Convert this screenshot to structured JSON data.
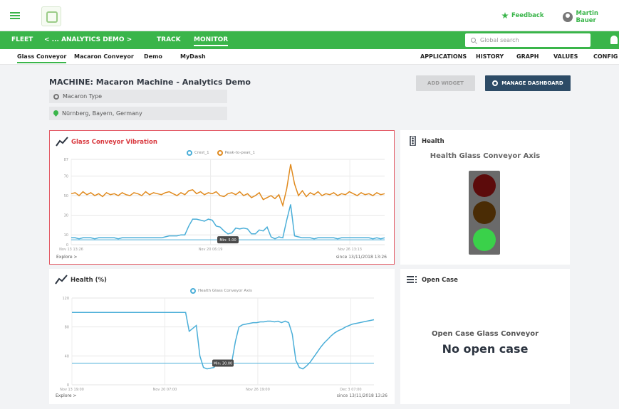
{
  "header": {
    "feedback": "Feedback",
    "user": "Martin Bauer"
  },
  "nav": {
    "fleet": "FLEET",
    "crumb": "< ... ANALYTICS DEMO >",
    "track": "TRACK",
    "monitor": "MONITOR",
    "search_placeholder": "Global search"
  },
  "subnav": {
    "left": [
      "Glass Conveyor",
      "Macaron Conveyor",
      "Demo",
      "MyDash"
    ],
    "right": [
      "APPLICATIONS",
      "HISTORY",
      "GRAPH",
      "VALUES",
      "CONFIG"
    ]
  },
  "page": {
    "title": "MACHINE: Macaron Machine - Analytics Demo",
    "type": "Macaron Type",
    "location": "Nürnberg, Bayern, Germany",
    "add_widget": "ADD WIDGET",
    "manage_dashboard": "MANAGE DASHBOARD"
  },
  "widgets": {
    "vibration": {
      "title": "Glass Conveyor Vibration",
      "explore": "Explore >",
      "since": "since 13/11/2018 13:26",
      "min_label": "Min: 5.00"
    },
    "health_light": {
      "title": "Health",
      "subtitle": "Health Glass Conveyor Axis",
      "colors": {
        "red": "#5c0b0b",
        "amber": "#4a2c05",
        "green": "#3ad14a"
      }
    },
    "health_pct": {
      "title": "Health (%)",
      "explore": "Explore >",
      "since": "since 13/11/2018 13:26",
      "min_label": "Min: 30.00"
    },
    "open_case": {
      "title": "Open Case",
      "subtitle": "Open Case Glass Conveyor",
      "value": "No open case"
    }
  },
  "chart_data": [
    {
      "type": "line",
      "series": [
        {
          "name": "Crest_1",
          "color": "#4aaed8",
          "values": [
            7,
            7,
            6,
            7,
            7,
            7,
            6,
            7,
            7,
            7,
            7,
            7,
            6,
            7,
            7,
            7,
            7,
            7,
            7,
            7,
            7,
            7,
            7,
            7,
            8,
            9,
            9,
            9,
            10,
            10,
            19,
            26,
            26,
            25,
            24,
            26,
            25,
            19,
            18,
            14,
            11,
            12,
            17,
            16,
            17,
            16,
            11,
            11,
            15,
            14,
            18,
            8,
            6,
            8,
            7,
            25,
            41,
            9,
            8,
            7,
            7,
            7,
            6,
            7,
            7,
            7,
            7,
            7,
            6,
            7,
            7,
            7,
            7,
            7,
            7,
            7,
            7,
            6,
            7,
            6,
            7
          ]
        },
        {
          "name": "Peak-to-peak_1",
          "color": "#e08a1e",
          "values": [
            52,
            53,
            50,
            54,
            51,
            53,
            50,
            52,
            49,
            53,
            51,
            52,
            50,
            53,
            51,
            50,
            53,
            52,
            50,
            54,
            51,
            53,
            52,
            51,
            53,
            54,
            52,
            50,
            53,
            51,
            55,
            56,
            52,
            54,
            51,
            53,
            52,
            54,
            50,
            49,
            52,
            53,
            51,
            54,
            50,
            52,
            48,
            50,
            53,
            46,
            48,
            50,
            47,
            51,
            40,
            57,
            82,
            62,
            50,
            55,
            49,
            53,
            51,
            54,
            50,
            52,
            51,
            53,
            50,
            52,
            51,
            54,
            52,
            50,
            53,
            51,
            52,
            50,
            53,
            51,
            52
          ]
        }
      ],
      "x_ticks": [
        "Nov 13 13:26",
        "Nov 20 06:19",
        "Nov 26 13:13"
      ],
      "y_ticks": [
        0,
        10,
        30,
        50,
        70,
        87
      ],
      "ylim": [
        0,
        87
      ],
      "min_line": 5
    },
    {
      "type": "line",
      "series": [
        {
          "name": "Health Glass Conveyor Axis",
          "color": "#4aaed8",
          "values": [
            100,
            100,
            100,
            100,
            100,
            100,
            100,
            100,
            100,
            100,
            100,
            100,
            100,
            100,
            100,
            100,
            100,
            100,
            100,
            100,
            100,
            100,
            100,
            100,
            100,
            100,
            100,
            100,
            100,
            100,
            100,
            100,
            100,
            74,
            78,
            82,
            40,
            24,
            22,
            23,
            24,
            32,
            28,
            30,
            28,
            32,
            60,
            80,
            83,
            84,
            85,
            86,
            86,
            87,
            87,
            88,
            88,
            87,
            88,
            86,
            88,
            86,
            70,
            34,
            24,
            22,
            26,
            31,
            38,
            45,
            52,
            58,
            63,
            68,
            72,
            75,
            77,
            80,
            82,
            84,
            85,
            86,
            87,
            88,
            89,
            90
          ]
        }
      ],
      "x_ticks": [
        "Nov 13 19:00",
        "Nov 20 07:00",
        "Nov 26 19:00",
        "Dec 3 07:00"
      ],
      "y_ticks": [
        0,
        40,
        80,
        120
      ],
      "ylim": [
        0,
        120
      ],
      "min_line": 30
    }
  ]
}
